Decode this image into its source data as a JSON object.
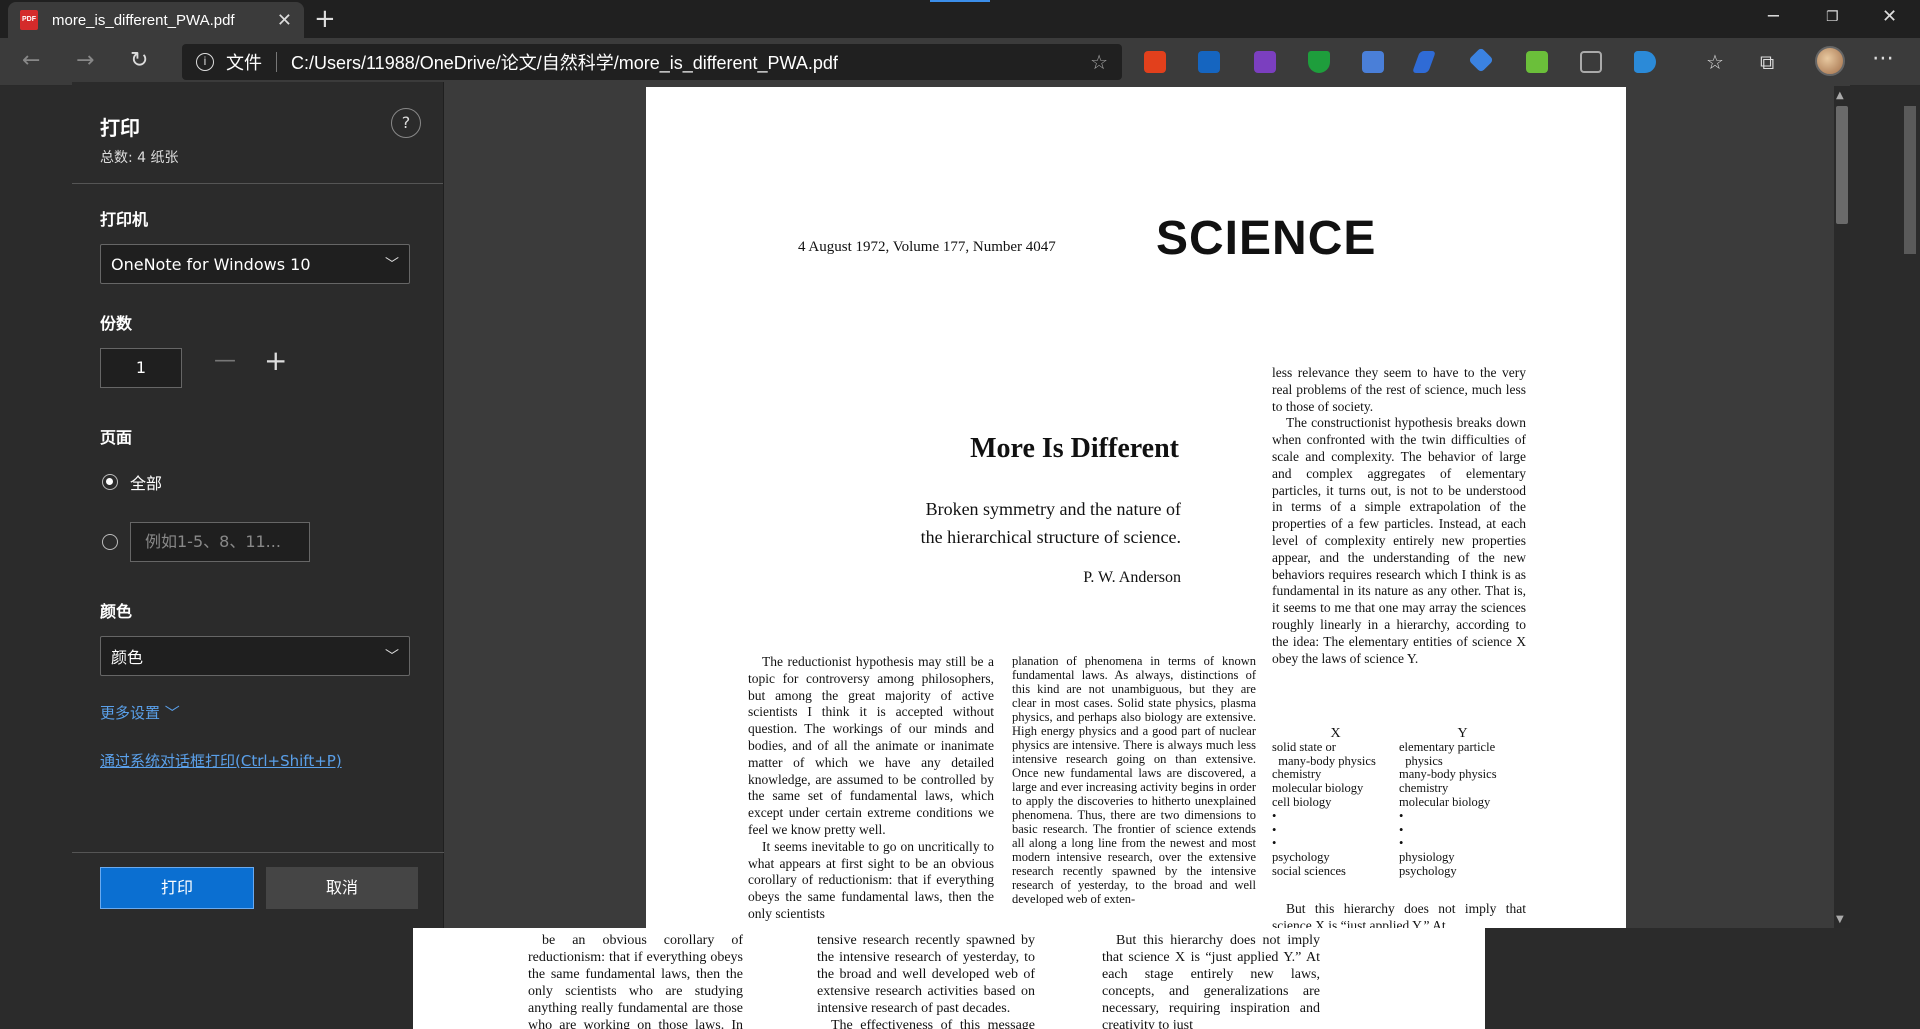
{
  "browser": {
    "tab_title": "more_is_different_PWA.pdf",
    "pdf_badge": "PDF",
    "close_glyph": "✕",
    "new_tab_glyph": "+",
    "address_label": "文件",
    "url": "C:/Users/11988/OneDrive/论文/自然科学/more_is_different_PWA.pdf",
    "colors": {
      "tab_active": "#3b3b3b",
      "toolbar": "#3b3b3b",
      "chrome_bg": "#202020",
      "accent": "#0b6fd1"
    }
  },
  "print_panel": {
    "title": "打印",
    "total": "总数: 4 纸张",
    "help": "?",
    "printer_label": "打印机",
    "printer_value": "OneNote for Windows 10",
    "copies_label": "份数",
    "copies_value": "1",
    "pages_label": "页面",
    "pages_all": "全部",
    "pages_range_placeholder": "例如1-5、8、11...",
    "color_label": "颜色",
    "color_value": "颜色",
    "more_settings": "更多设置",
    "system_dialog": "通过系统对话框打印(Ctrl+Shift+P)",
    "print_button": "打印",
    "cancel_button": "取消"
  },
  "pdf_page": {
    "date_line": "4 August 1972, Volume 177, Number 4047",
    "journal": "SCIENCE",
    "title": "More Is Different",
    "subtitle_1": "Broken symmetry and the nature of",
    "subtitle_2": "the hierarchical structure of science.",
    "author": "P. W. Anderson",
    "col1_p1": "The reductionist hypothesis may still be a topic for controversy among philosophers, but among the great majority of active scientists I think it is accepted without question. The workings of our minds and bodies, and of all the animate or inanimate matter of which we have any detailed knowledge, are assumed to be controlled by the same set of fundamental laws, which except under certain extreme conditions we feel we know pretty well.",
    "col1_p2": "It seems inevitable to go on uncritically to what appears at first sight to be an obvious corollary of reductionism: that if everything obeys the same fundamental laws, then the only scientists",
    "col2_p1": "planation of phenomena in terms of known fundamental laws. As always, distinctions of this kind are not unambiguous, but they are clear in most cases. Solid state physics, plasma physics, and perhaps also biology are extensive. High energy physics and a good part of nuclear physics are intensive. There is always much less intensive research going on than extensive. Once new fundamental laws are discovered, a large and ever increasing activity begins in order to apply the discoveries to hitherto unexplained phenomena. Thus, there are two dimensions to basic research. The frontier of science extends all along a long line from the newest and most modern intensive research, over the extensive research recently spawned by the intensive research of yesterday, to the broad and well developed web of exten-",
    "col3_p1": "less relevance they seem to have to the very real problems of the rest of science, much less to those of society.",
    "col3_p2": "The constructionist hypothesis breaks down when confronted with the twin difficulties of scale and complexity. The behavior of large and complex aggregates of elementary particles, it turns out, is not to be understood in terms of a simple extrapolation of the properties of a few particles. Instead, at each level of complexity entirely new properties appear, and the understanding of the new behaviors requires research which I think is as fundamental in its nature as any other. That is, it seems to me that one may array the sciences roughly linearly in a hierarchy, according to the idea: The elementary entities of science X obey the laws of science Y.",
    "hier_x": "X",
    "hier_y": "Y",
    "hier_x_items": "solid state or\n  many-body physics\nchemistry\nmolecular biology\ncell biology\n•\n•\n•\npsychology\nsocial sciences",
    "hier_y_items": "elementary particle\n  physics\nmany-body physics\nchemistry\nmolecular biology\n•\n•\n•\nphysiology\npsychology",
    "col3_p3": "But this hierarchy does not imply that science X is “just applied Y.” At"
  },
  "under_page": {
    "c1": "be an obvious corollary of reductionism: that if everything obeys the same fundamental laws, then the only scientists who are studying anything really fundamental are those who are working on those laws. In practice, that amounts",
    "c2": "tensive research recently spawned by the intensive research of yesterday, to the broad and well developed web of extensive research activities based on intensive research of past decades.",
    "c2b": "The effectiveness of this message may",
    "c3": "But this hierarchy does not imply that science X is “just applied Y.” At each stage entirely new laws, concepts, and generalizations are necessary, requiring inspiration and creativity to just"
  }
}
